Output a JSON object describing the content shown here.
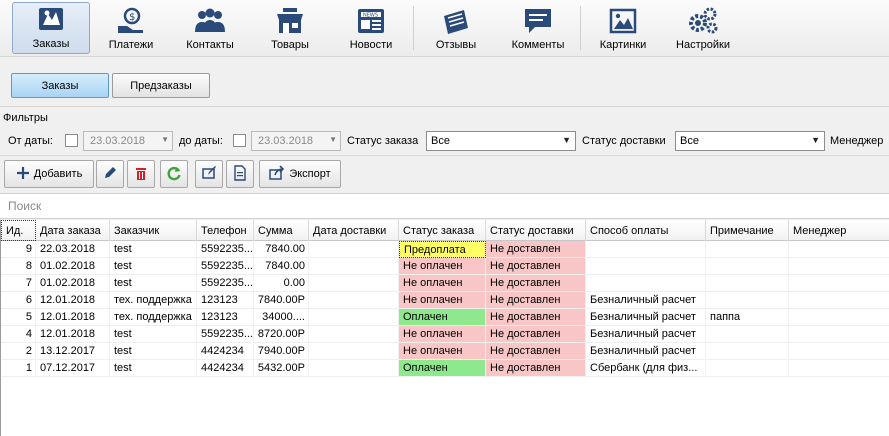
{
  "ribbon": [
    {
      "label": "Заказы",
      "icon": "orders-icon",
      "active": true
    },
    {
      "label": "Платежи",
      "icon": "payments-icon"
    },
    {
      "label": "Контакты",
      "icon": "contacts-icon"
    },
    {
      "label": "Товары",
      "icon": "store-icon"
    },
    {
      "label": "Новости",
      "icon": "news-icon"
    },
    {
      "label": "Отзывы",
      "icon": "reviews-icon"
    },
    {
      "label": "Комменты",
      "icon": "comments-icon"
    },
    {
      "label": "Картинки",
      "icon": "pictures-icon"
    },
    {
      "label": "Настройки",
      "icon": "settings-icon"
    }
  ],
  "tabs": {
    "orders": "Заказы",
    "preorders": "Предзаказы"
  },
  "filters": {
    "title": "Фильтры",
    "from_label": "От даты:",
    "from_value": "23.03.2018",
    "to_label": "до даты:",
    "to_value": "23.03.2018",
    "order_status_label": "Статус заказа",
    "order_status_value": "Все",
    "delivery_status_label": "Статус доставки",
    "delivery_status_value": "Все",
    "manager_label": "Менеджер"
  },
  "actions": {
    "add": "Добавить",
    "export": "Экспорт"
  },
  "search": {
    "placeholder": "Поиск"
  },
  "table": {
    "columns": [
      "Ид.",
      "Дата заказа",
      "Заказчик",
      "Телефон",
      "Сумма",
      "Дата доставки",
      "Статус заказа",
      "Статус доставки",
      "Способ оплаты",
      "Примечание",
      "Менеджер"
    ],
    "rows": [
      {
        "id": "9",
        "date": "22.03.2018",
        "customer": "test",
        "phone": "5592235...",
        "sum": "7840.00",
        "delivery_date": "",
        "status": "Предоплата",
        "status_kind": "prepay",
        "delivery": "Не доставлен",
        "payment": "",
        "note": "",
        "manager": ""
      },
      {
        "id": "8",
        "date": "01.02.2018",
        "customer": "test",
        "phone": "5592235...",
        "sum": "7840.00",
        "delivery_date": "",
        "status": "Не оплачен",
        "status_kind": "unpaid",
        "delivery": "Не доставлен",
        "payment": "",
        "note": "",
        "manager": ""
      },
      {
        "id": "7",
        "date": "01.02.2018",
        "customer": "test",
        "phone": "5592235...",
        "sum": "0.00",
        "delivery_date": "",
        "status": "Не оплачен",
        "status_kind": "unpaid",
        "delivery": "Не доставлен",
        "payment": "",
        "note": "",
        "manager": ""
      },
      {
        "id": "6",
        "date": "12.01.2018",
        "customer": "тех. поддержка",
        "phone": "123123",
        "sum": "7840.00Р",
        "delivery_date": "",
        "status": "Не оплачен",
        "status_kind": "unpaid",
        "delivery": "Не доставлен",
        "payment": "Безналичный расчет",
        "note": "",
        "manager": ""
      },
      {
        "id": "5",
        "date": "12.01.2018",
        "customer": "тех. поддержка",
        "phone": "123123",
        "sum": "34000....",
        "delivery_date": "",
        "status": "Оплачен",
        "status_kind": "paid",
        "delivery": "Не доставлен",
        "payment": "Безналичный расчет",
        "note": "паппа",
        "manager": ""
      },
      {
        "id": "4",
        "date": "12.01.2018",
        "customer": "test",
        "phone": "5592235...",
        "sum": "8720.00Р",
        "delivery_date": "",
        "status": "Не оплачен",
        "status_kind": "unpaid",
        "delivery": "Не доставлен",
        "payment": "Безналичный расчет",
        "note": "",
        "manager": ""
      },
      {
        "id": "2",
        "date": "13.12.2017",
        "customer": "test",
        "phone": "4424234",
        "sum": "7940.00Р",
        "delivery_date": "",
        "status": "Не оплачен",
        "status_kind": "unpaid",
        "delivery": "Не доставлен",
        "payment": "Безналичный расчет",
        "note": "",
        "manager": ""
      },
      {
        "id": "1",
        "date": "07.12.2017",
        "customer": "test",
        "phone": "4424234",
        "sum": "5432.00Р",
        "delivery_date": "",
        "status": "Оплачен",
        "status_kind": "paid",
        "delivery": "Не доставлен",
        "payment": "Сбербанк (для физ...",
        "note": "",
        "manager": ""
      }
    ]
  },
  "colors": {
    "accent": "#2a4a7a",
    "prepay": "#ffff66",
    "unpaid": "#f8c6c6",
    "paid": "#8ee88e"
  }
}
